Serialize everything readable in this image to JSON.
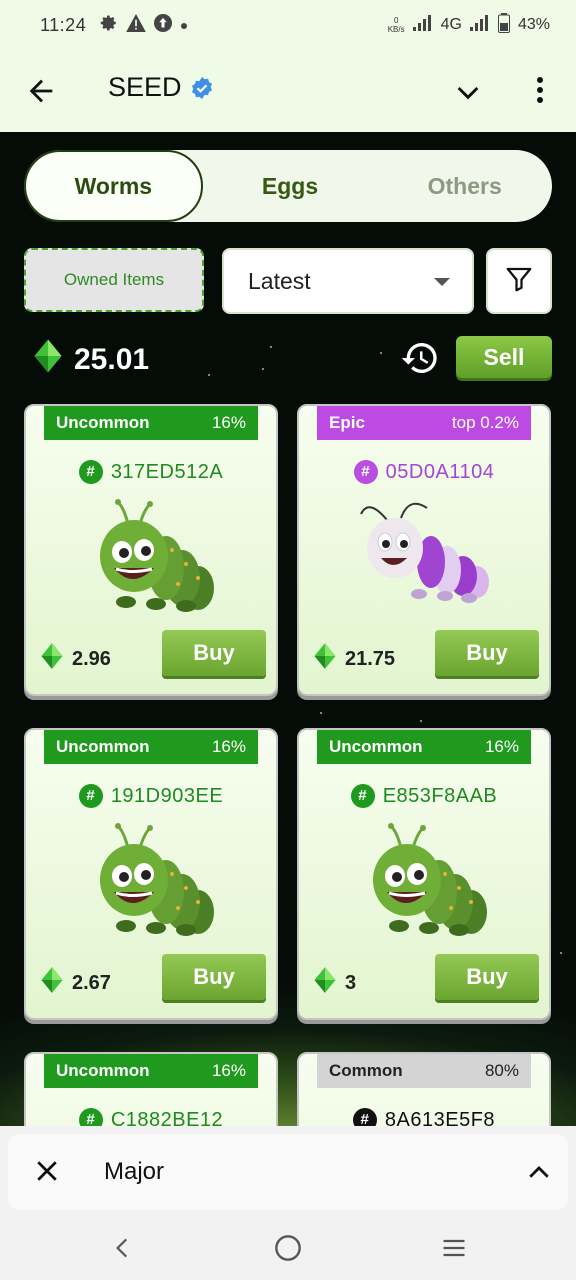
{
  "status": {
    "time": "11:24",
    "net_speed": "0",
    "net_unit": "KB/s",
    "network": "4G",
    "battery": "43%"
  },
  "header": {
    "title": "SEED"
  },
  "tabs": [
    {
      "label": "Worms"
    },
    {
      "label": "Eggs"
    },
    {
      "label": "Others"
    }
  ],
  "filters": {
    "owned_label": "Owned Items",
    "sort_value": "Latest"
  },
  "balance": {
    "value": "25.01",
    "sell_label": "Sell"
  },
  "buy_label": "Buy",
  "cards": [
    {
      "rarity": "Uncommon",
      "pct": "16%",
      "id": "317ED512A",
      "price": "2.96"
    },
    {
      "rarity": "Epic",
      "pct": "top 0.2%",
      "id": "05D0A1104",
      "price": "21.75"
    },
    {
      "rarity": "Uncommon",
      "pct": "16%",
      "id": "191D903EE",
      "price": "2.67"
    },
    {
      "rarity": "Uncommon",
      "pct": "16%",
      "id": "E853F8AAB",
      "price": "3"
    },
    {
      "rarity": "Uncommon",
      "pct": "16%",
      "id": "C1882BE12",
      "price": ""
    },
    {
      "rarity": "Common",
      "pct": "80%",
      "id": "8A613E5F8",
      "price": ""
    }
  ],
  "sheet": {
    "label": "Major"
  },
  "colors": {
    "accent": "#1f9a1f",
    "epic": "#bd4be3",
    "background": "#050b07"
  }
}
